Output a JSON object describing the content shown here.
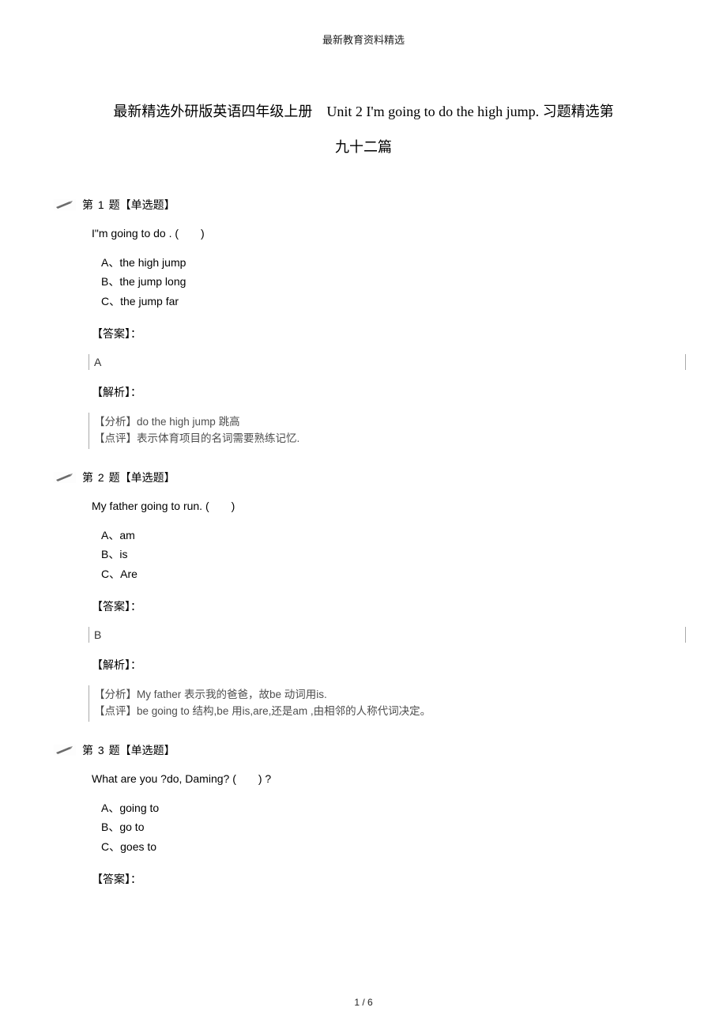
{
  "header": "最新教育资料精选",
  "title_line1": "最新精选外研版英语四年级上册 Unit 2 I'm going to do the high jump. 习题精选第",
  "title_line2": "九十二篇",
  "labels": {
    "prefix": "第",
    "suffix": "题【单选题】",
    "answer": "【答案】：",
    "analysis": "【解析】：",
    "fenxi": "【分析】",
    "dianping": "【点评】"
  },
  "questions": [
    {
      "num": "1",
      "stem": "I\"m going to do . (  )",
      "options": [
        {
          "l": "A",
          "t": "the high jump"
        },
        {
          "l": "B",
          "t": "the jump long"
        },
        {
          "l": "C",
          "t": "the jump far"
        }
      ],
      "answer": "A",
      "analysis": [
        "do the high jump 跳高",
        "表示体育项目的名词需要熟练记忆."
      ]
    },
    {
      "num": "2",
      "stem": "My father going to run. (  )",
      "options": [
        {
          "l": "A",
          "t": "am"
        },
        {
          "l": "B",
          "t": "is"
        },
        {
          "l": "C",
          "t": "Are"
        }
      ],
      "answer": "B",
      "analysis": [
        "My father 表示我的爸爸，故be 动词用is.",
        "be going to 结构,be 用is,are,还是am ,由相邻的人称代词决定。"
      ]
    },
    {
      "num": "3",
      "stem": "What are you ?do, Daming? (  ) ?",
      "options": [
        {
          "l": "A",
          "t": "going to"
        },
        {
          "l": "B",
          "t": "go to"
        },
        {
          "l": "C",
          "t": "goes to"
        }
      ],
      "answer": "",
      "analysis": []
    }
  ],
  "footer": "1 / 6"
}
